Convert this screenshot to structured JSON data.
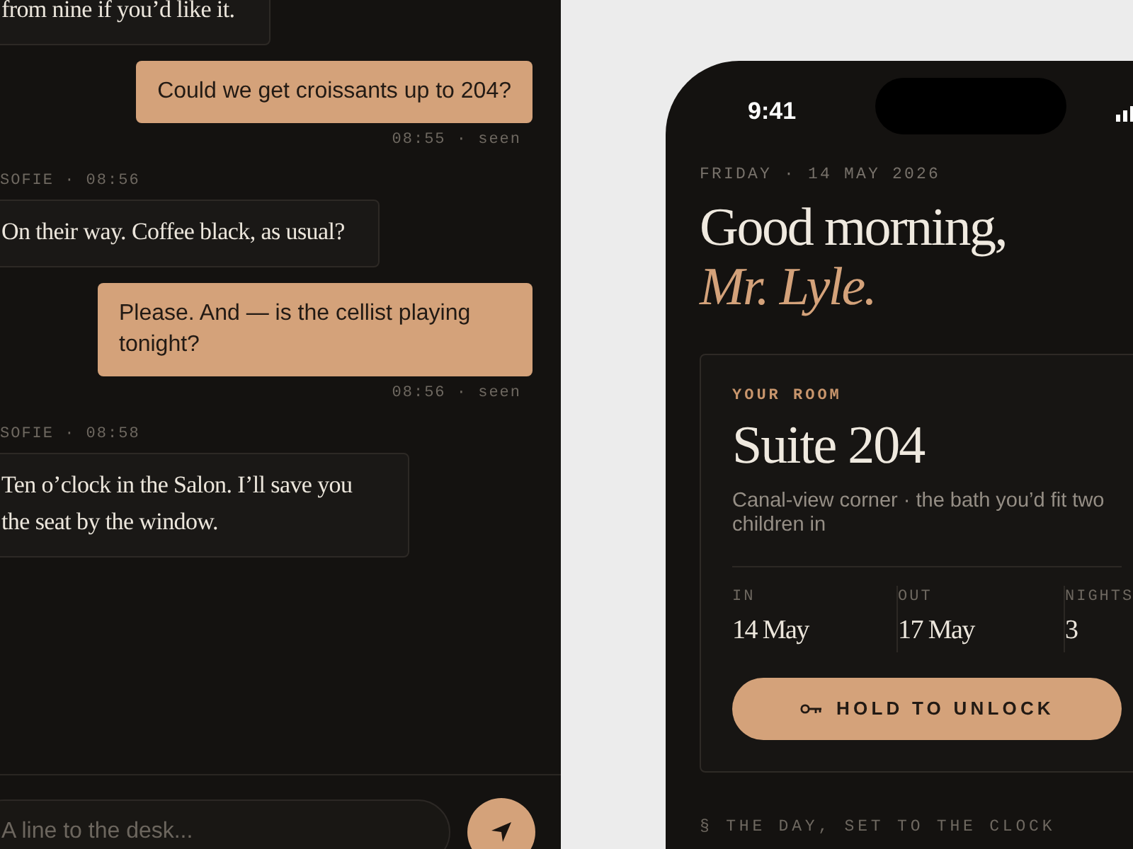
{
  "chat": {
    "messages": [
      {
        "kind": "incoming",
        "text": "from nine if you’d like it."
      },
      {
        "kind": "outgoing",
        "text": "Could we get croissants up to 204?",
        "meta": "08:55 · seen"
      },
      {
        "kind": "incoming",
        "meta": "SOFIE · 08:56",
        "text": "On their way. Coffee black, as usual?"
      },
      {
        "kind": "outgoing",
        "text": "Please. And — is the cellist playing tonight?",
        "meta": "08:56 · seen"
      },
      {
        "kind": "incoming",
        "meta": "SOFIE · 08:58",
        "text": "Ten o’clock in the Salon. I’ll save you the seat by the window."
      }
    ],
    "composer": {
      "placeholder": "A line to the desk..."
    }
  },
  "phone": {
    "status_bar": {
      "time": "9:41"
    },
    "date": "FRIDAY · 14 MAY 2026",
    "greeting": "Good morning,",
    "guest_name": "Mr. Lyle.",
    "room_card": {
      "label": "YOUR ROOM",
      "title": "Suite 204",
      "description": "Canal-view corner · the bath you’d fit two children in",
      "stats": [
        {
          "label": "IN",
          "value": "14 May"
        },
        {
          "label": "OUT",
          "value": "17 May"
        },
        {
          "label": "NIGHTS",
          "value": "3"
        }
      ],
      "button": "HOLD TO UNLOCK"
    },
    "section_title": "§ THE DAY, SET TO THE CLOCK"
  }
}
